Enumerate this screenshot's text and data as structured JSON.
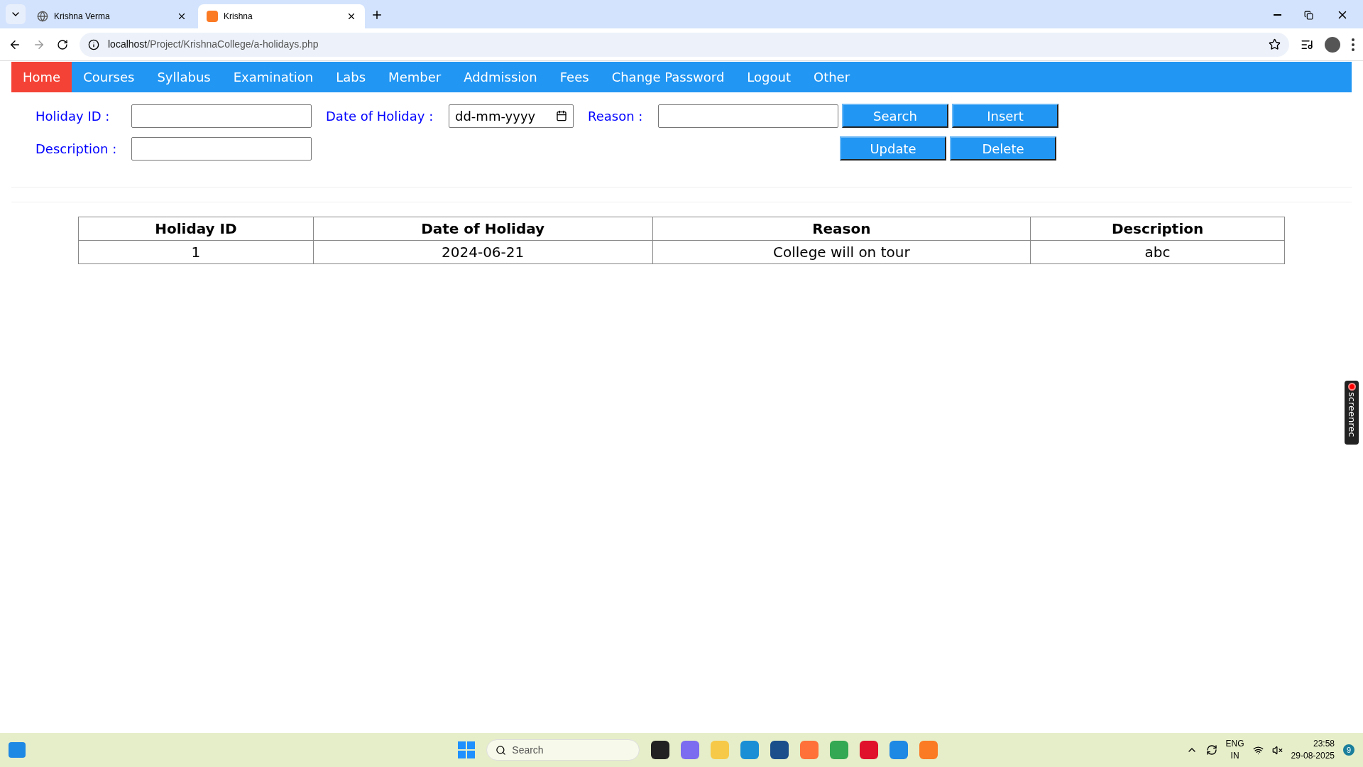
{
  "browser": {
    "tabs": [
      {
        "title": "Krishna Verma",
        "selected": false
      },
      {
        "title": "Krishna",
        "selected": true
      }
    ],
    "url_host": "localhost",
    "url_path": "/Project/KrishnaCollege/a-holidays.php"
  },
  "nav": [
    {
      "label": "Home",
      "selected": true
    },
    {
      "label": "Courses",
      "selected": false
    },
    {
      "label": "Syllabus",
      "selected": false
    },
    {
      "label": "Examination",
      "selected": false
    },
    {
      "label": "Labs",
      "selected": false
    },
    {
      "label": "Member",
      "selected": false
    },
    {
      "label": "Addmission",
      "selected": false
    },
    {
      "label": "Fees",
      "selected": false
    },
    {
      "label": "Change Password",
      "selected": false
    },
    {
      "label": "Logout",
      "selected": false
    },
    {
      "label": "Other",
      "selected": false
    }
  ],
  "form": {
    "holiday_id_label": "Holiday ID :",
    "date_label": "Date of Holiday :",
    "date_placeholder": "dd-mm-yyyy",
    "reason_label": "Reason :",
    "description_label": "Description :",
    "buttons_row1": [
      "Search",
      "Insert"
    ],
    "buttons_row2": [
      "Update",
      "Delete"
    ]
  },
  "table": {
    "columns": [
      "Holiday ID",
      "Date of Holiday",
      "Reason",
      "Description"
    ],
    "rows": [
      [
        "1",
        "2024-06-21",
        "College will on tour",
        "abc"
      ]
    ]
  },
  "recorder_widget": {
    "label": "screenrec"
  },
  "taskbar": {
    "search_placeholder": "Search",
    "language": "ENG",
    "region": "IN",
    "time": "23:58",
    "date": "29-08-2025",
    "notifications": "9"
  }
}
